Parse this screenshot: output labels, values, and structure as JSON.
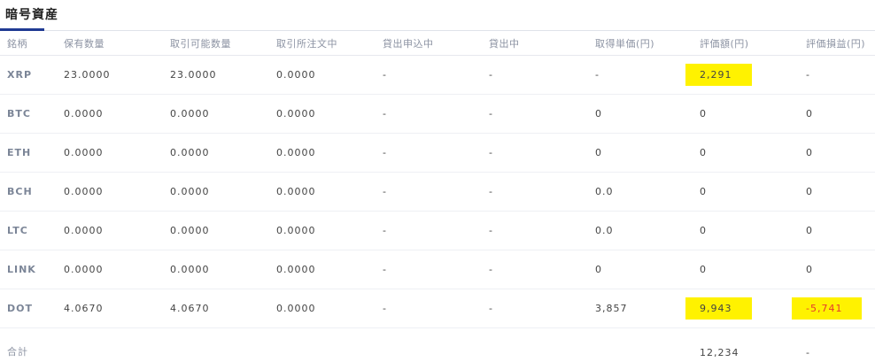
{
  "title": "暗号資産",
  "headers": [
    "銘柄",
    "保有数量",
    "取引可能数量",
    "取引所注文中",
    "貸出申込中",
    "貸出中",
    "取得単価(円)",
    "評価額(円)",
    "評価損益(円)"
  ],
  "rows": [
    {
      "symbol": "XRP",
      "holding": "23.0000",
      "tradable": "23.0000",
      "ordering": "0.0000",
      "lend_applying": "-",
      "lending": "-",
      "acq_price": "-",
      "valuation": "2,291",
      "pl": "-"
    },
    {
      "symbol": "BTC",
      "holding": "0.0000",
      "tradable": "0.0000",
      "ordering": "0.0000",
      "lend_applying": "-",
      "lending": "-",
      "acq_price": "0",
      "valuation": "0",
      "pl": "0"
    },
    {
      "symbol": "ETH",
      "holding": "0.0000",
      "tradable": "0.0000",
      "ordering": "0.0000",
      "lend_applying": "-",
      "lending": "-",
      "acq_price": "0",
      "valuation": "0",
      "pl": "0"
    },
    {
      "symbol": "BCH",
      "holding": "0.0000",
      "tradable": "0.0000",
      "ordering": "0.0000",
      "lend_applying": "-",
      "lending": "-",
      "acq_price": "0.0",
      "valuation": "0",
      "pl": "0"
    },
    {
      "symbol": "LTC",
      "holding": "0.0000",
      "tradable": "0.0000",
      "ordering": "0.0000",
      "lend_applying": "-",
      "lending": "-",
      "acq_price": "0.0",
      "valuation": "0",
      "pl": "0"
    },
    {
      "symbol": "LINK",
      "holding": "0.0000",
      "tradable": "0.0000",
      "ordering": "0.0000",
      "lend_applying": "-",
      "lending": "-",
      "acq_price": "0",
      "valuation": "0",
      "pl": "0"
    },
    {
      "symbol": "DOT",
      "holding": "4.0670",
      "tradable": "4.0670",
      "ordering": "0.0000",
      "lend_applying": "-",
      "lending": "-",
      "acq_price": "3,857",
      "valuation": "9,943",
      "pl": "-5,741"
    }
  ],
  "total": {
    "label": "合計",
    "valuation": "12,234",
    "pl": "-"
  },
  "colors": {
    "accent": "#1f3a93",
    "highlight": "#fff200",
    "negative": "#e5392e",
    "symbol": "#7b8597"
  }
}
